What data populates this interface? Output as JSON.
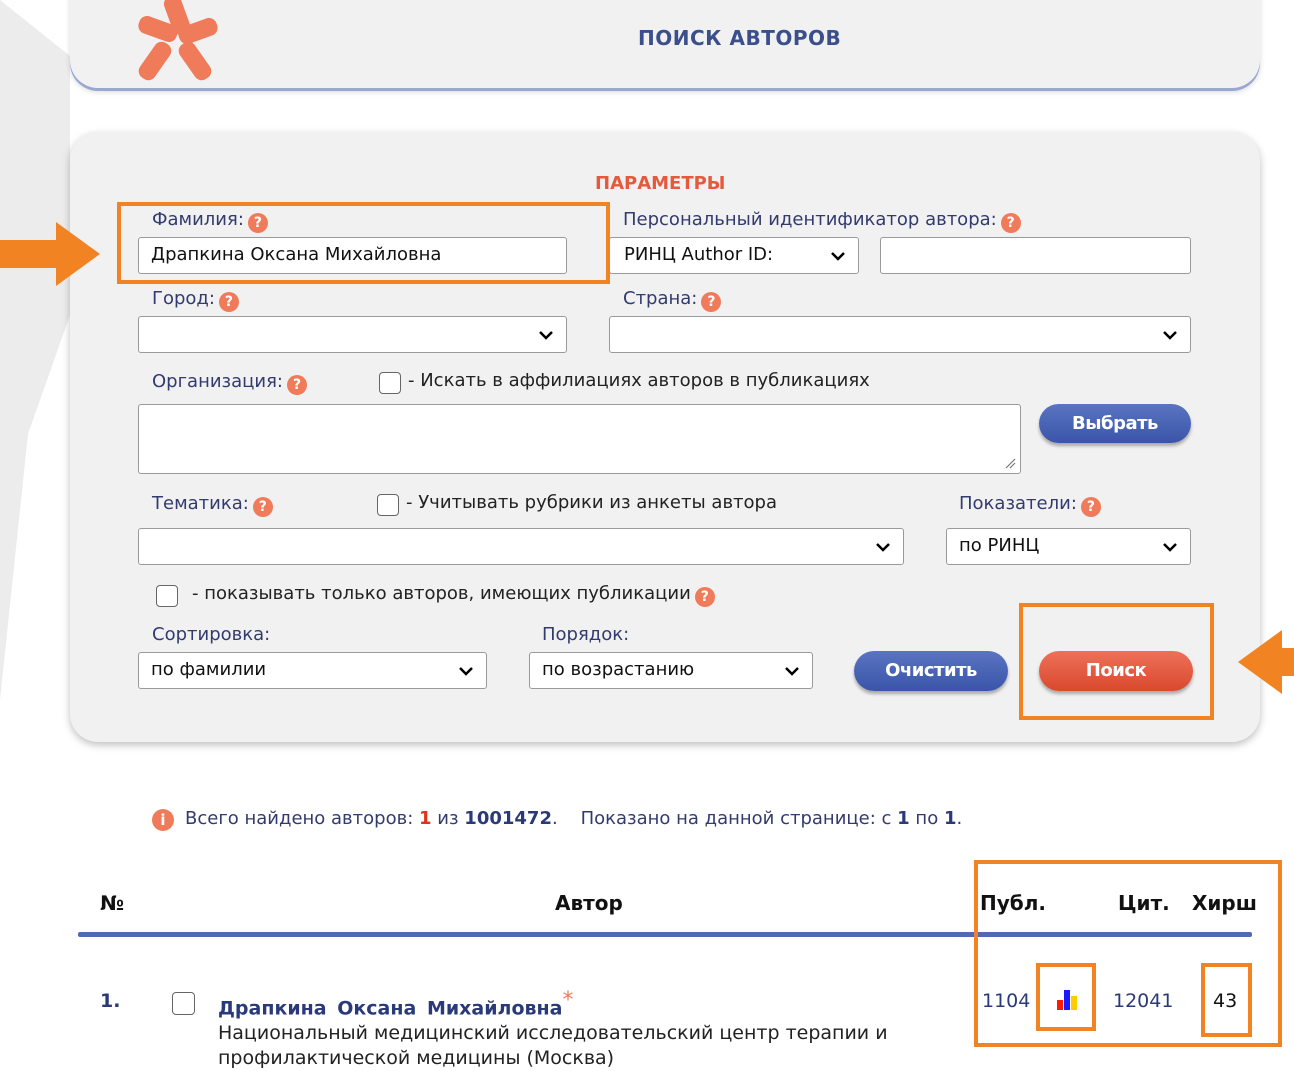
{
  "header": {
    "title": "ПОИСК АВТОРОВ"
  },
  "params": {
    "title": "ПАРАМЕТРЫ",
    "surname_label": "Фамилия:",
    "surname_value": "Драпкина Оксана Михайловна",
    "personal_id_label": "Персональный идентификатор автора:",
    "id_type_value": "РИНЦ Author ID:",
    "id_value": "",
    "city_label": "Город:",
    "city_value": "",
    "country_label": "Страна:",
    "country_value": "",
    "org_label": "Организация:",
    "org_affiliation_checkbox": "- Искать в аффилиациях авторов в публикациях",
    "org_value": "",
    "select_button": "Выбрать",
    "topic_label": "Тематика:",
    "topic_checkbox": "- Учитывать рубрики из анкеты автора",
    "topic_value": "",
    "indicators_label": "Показатели:",
    "indicators_value": "по РИНЦ",
    "only_with_pubs_checkbox": "- показывать только авторов, имеющих публикации",
    "sort_label": "Сортировка:",
    "sort_value": "по фамилии",
    "order_label": "Порядок:",
    "order_value": "по возрастанию",
    "clear_button": "Очистить",
    "search_button": "Поиск",
    "help_glyph": "?"
  },
  "summary": {
    "found_prefix": "Всего найдено авторов:",
    "found_count": "1",
    "of_word": "из",
    "total": "1001472",
    "shown_prefix": "Показано на данной странице: с",
    "shown_from": "1",
    "to_word": "по",
    "shown_to": "1",
    "info_glyph": "i"
  },
  "table": {
    "headers": {
      "num": "№",
      "author": "Автор",
      "pubs": "Публ.",
      "cites": "Цит.",
      "hirsch": "Хирш"
    },
    "rows": [
      {
        "num": "1.",
        "name": "Драпкина Оксана Михайловна",
        "marker": "*",
        "affiliation_line1": "Национальный медицинский исследовательский центр терапии и",
        "affiliation_line2": "профилактической медицины (Москва)",
        "pubs": "1104",
        "cites": "12041",
        "hirsch": "43"
      }
    ]
  },
  "colors": {
    "accent_orange": "#f28322",
    "brand_blue": "#3a4f8b",
    "red_text": "#e55a3c"
  }
}
